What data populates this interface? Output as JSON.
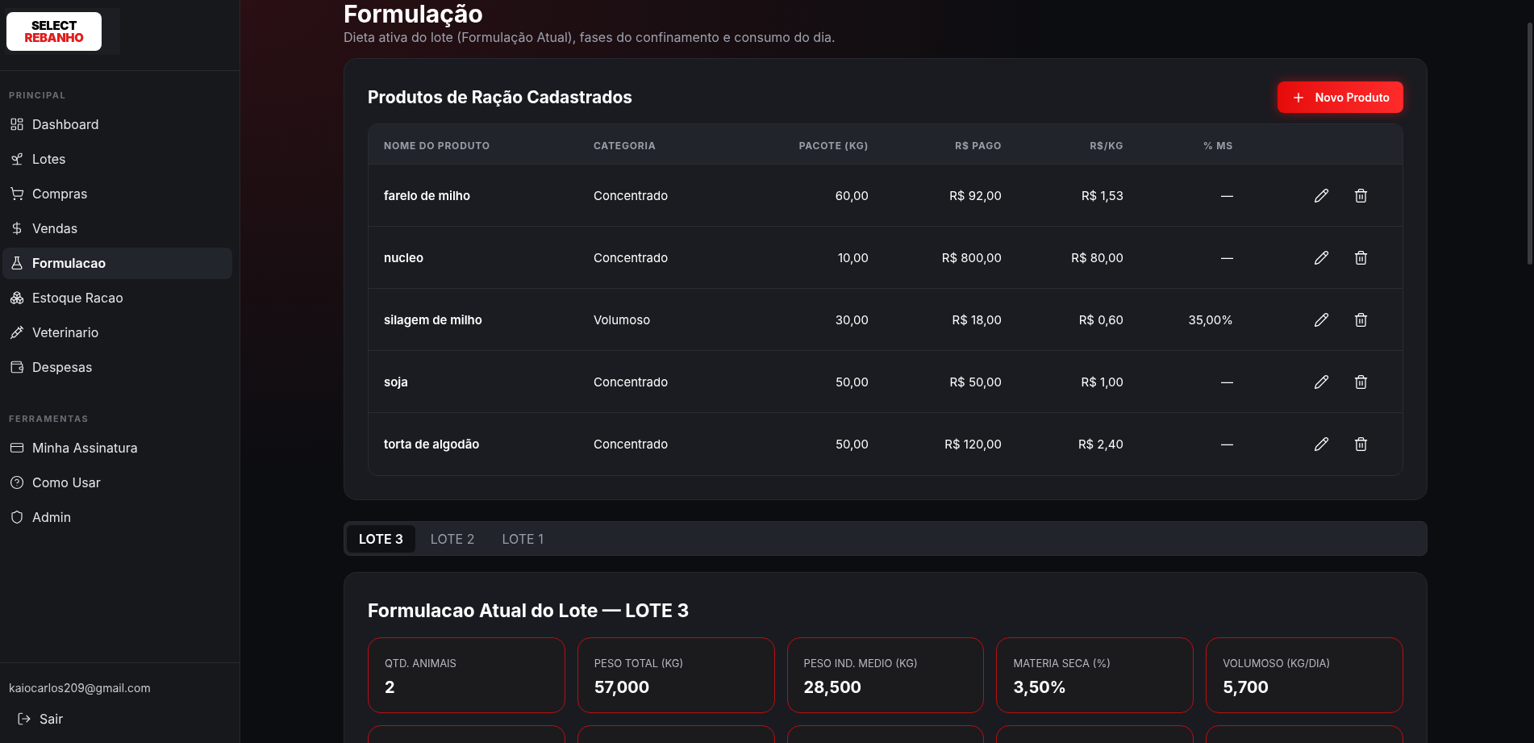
{
  "logo": {
    "line_1": "SELECT",
    "line_2": "REBANHO"
  },
  "sidebar": {
    "sections": [
      {
        "title": "PRINCIPAL",
        "items": [
          {
            "label": "Dashboard",
            "selected": false
          },
          {
            "label": "Lotes",
            "selected": false
          },
          {
            "label": "Compras",
            "selected": false
          },
          {
            "label": "Vendas",
            "selected": false
          },
          {
            "label": "Formulacao",
            "selected": true
          },
          {
            "label": "Estoque Racao",
            "selected": false
          },
          {
            "label": "Veterinario",
            "selected": false
          },
          {
            "label": "Despesas",
            "selected": false
          }
        ]
      },
      {
        "title": "FERRAMENTAS",
        "items": [
          {
            "label": "Minha Assinatura",
            "selected": false
          },
          {
            "label": "Como Usar",
            "selected": false
          },
          {
            "label": "Admin",
            "selected": false
          }
        ]
      }
    ],
    "user_email": "kaiocarlos209@gmail.com",
    "logout": "Sair"
  },
  "page": {
    "title": "Formulação",
    "subtitle": "Dieta ativa do lote (Formulação Atual), fases do confinamento e consumo do dia."
  },
  "products": {
    "title": "Produtos de Ração Cadastrados",
    "new_button": "Novo Produto",
    "columns": [
      "NOME DO PRODUTO",
      "CATEGORIA",
      "PACOTE (KG)",
      "R$ PAGO",
      "R$/KG",
      "% MS"
    ],
    "rows": [
      [
        "farelo de milho",
        "Concentrado",
        "60,00",
        "R$ 92,00",
        "R$ 1,53",
        "—"
      ],
      [
        "nucleo",
        "Concentrado",
        "10,00",
        "R$ 800,00",
        "R$ 80,00",
        "—"
      ],
      [
        "silagem de milho",
        "Volumoso",
        "30,00",
        "R$ 18,00",
        "R$ 0,60",
        "35,00%"
      ],
      [
        "soja",
        "Concentrado",
        "50,00",
        "R$ 50,00",
        "R$ 1,00",
        "—"
      ],
      [
        "torta de algodão",
        "Concentrado",
        "50,00",
        "R$ 120,00",
        "R$ 2,40",
        "—"
      ]
    ]
  },
  "lot_tabs": [
    {
      "label": "LOTE 3",
      "selected": true
    },
    {
      "label": "LOTE 2",
      "selected": false
    },
    {
      "label": "LOTE 1",
      "selected": false
    }
  ],
  "formulation": {
    "title": "Formulacao Atual do Lote — LOTE 3",
    "stats": [
      {
        "label": "QTD. ANIMAIS",
        "value": "2"
      },
      {
        "label": "PESO TOTAL (KG)",
        "value": "57,000"
      },
      {
        "label": "PESO IND. MEDIO (KG)",
        "value": "28,500"
      },
      {
        "label": "MATERIA SECA (%)",
        "value": "3,50%"
      },
      {
        "label": "VOLUMOSO (KG/DIA)",
        "value": "5,700"
      }
    ]
  }
}
